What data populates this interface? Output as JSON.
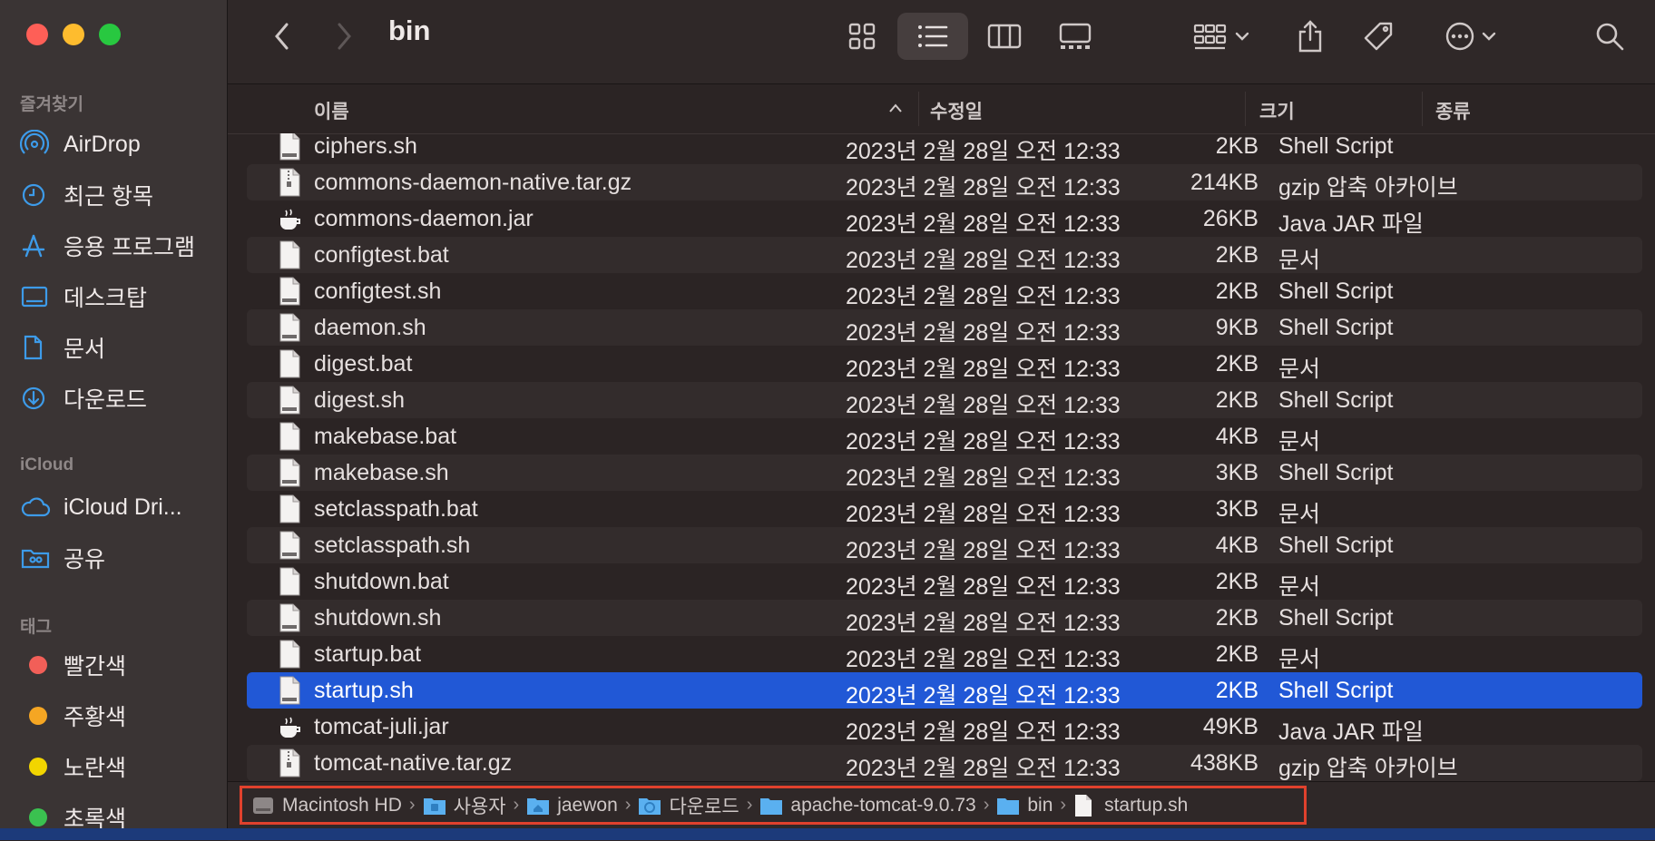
{
  "window": {
    "title": "bin"
  },
  "sidebar": {
    "favorites_heading": "즐겨찾기",
    "favorites": [
      {
        "label": "AirDrop",
        "icon": "airdrop-icon"
      },
      {
        "label": "최근 항목",
        "icon": "clock-icon"
      },
      {
        "label": "응용 프로그램",
        "icon": "applications-icon"
      },
      {
        "label": "데스크탑",
        "icon": "desktop-icon"
      },
      {
        "label": "문서",
        "icon": "document-icon"
      },
      {
        "label": "다운로드",
        "icon": "download-icon"
      }
    ],
    "icloud_heading": "iCloud",
    "icloud": [
      {
        "label": "iCloud Dri...",
        "icon": "cloud-icon"
      },
      {
        "label": "공유",
        "icon": "shared-folder-icon"
      }
    ],
    "tags_heading": "태그",
    "tags": [
      {
        "label": "빨간색",
        "color": "#f25f58"
      },
      {
        "label": "주황색",
        "color": "#f5a623"
      },
      {
        "label": "노란색",
        "color": "#f2d500"
      },
      {
        "label": "초록색",
        "color": "#3ac150"
      }
    ]
  },
  "columns": {
    "name": "이름",
    "date": "수정일",
    "size": "크기",
    "kind": "종류"
  },
  "files": [
    {
      "name": "ciphers.sh",
      "date": "2023년 2월 28일 오전 12:33",
      "size": "2KB",
      "kind": "Shell Script",
      "icon": "shell-script-icon"
    },
    {
      "name": "commons-daemon-native.tar.gz",
      "date": "2023년 2월 28일 오전 12:33",
      "size": "214KB",
      "kind": "gzip 압축 아카이브",
      "icon": "archive-icon"
    },
    {
      "name": "commons-daemon.jar",
      "date": "2023년 2월 28일 오전 12:33",
      "size": "26KB",
      "kind": "Java JAR 파일",
      "icon": "java-jar-icon"
    },
    {
      "name": "configtest.bat",
      "date": "2023년 2월 28일 오전 12:33",
      "size": "2KB",
      "kind": "문서",
      "icon": "document-icon"
    },
    {
      "name": "configtest.sh",
      "date": "2023년 2월 28일 오전 12:33",
      "size": "2KB",
      "kind": "Shell Script",
      "icon": "shell-script-icon"
    },
    {
      "name": "daemon.sh",
      "date": "2023년 2월 28일 오전 12:33",
      "size": "9KB",
      "kind": "Shell Script",
      "icon": "shell-script-icon"
    },
    {
      "name": "digest.bat",
      "date": "2023년 2월 28일 오전 12:33",
      "size": "2KB",
      "kind": "문서",
      "icon": "document-icon"
    },
    {
      "name": "digest.sh",
      "date": "2023년 2월 28일 오전 12:33",
      "size": "2KB",
      "kind": "Shell Script",
      "icon": "shell-script-icon"
    },
    {
      "name": "makebase.bat",
      "date": "2023년 2월 28일 오전 12:33",
      "size": "4KB",
      "kind": "문서",
      "icon": "document-icon"
    },
    {
      "name": "makebase.sh",
      "date": "2023년 2월 28일 오전 12:33",
      "size": "3KB",
      "kind": "Shell Script",
      "icon": "shell-script-icon"
    },
    {
      "name": "setclasspath.bat",
      "date": "2023년 2월 28일 오전 12:33",
      "size": "3KB",
      "kind": "문서",
      "icon": "document-icon"
    },
    {
      "name": "setclasspath.sh",
      "date": "2023년 2월 28일 오전 12:33",
      "size": "4KB",
      "kind": "Shell Script",
      "icon": "shell-script-icon"
    },
    {
      "name": "shutdown.bat",
      "date": "2023년 2월 28일 오전 12:33",
      "size": "2KB",
      "kind": "문서",
      "icon": "document-icon"
    },
    {
      "name": "shutdown.sh",
      "date": "2023년 2월 28일 오전 12:33",
      "size": "2KB",
      "kind": "Shell Script",
      "icon": "shell-script-icon"
    },
    {
      "name": "startup.bat",
      "date": "2023년 2월 28일 오전 12:33",
      "size": "2KB",
      "kind": "문서",
      "icon": "document-icon"
    },
    {
      "name": "startup.sh",
      "date": "2023년 2월 28일 오전 12:33",
      "size": "2KB",
      "kind": "Shell Script",
      "icon": "shell-script-icon",
      "selected": true
    },
    {
      "name": "tomcat-juli.jar",
      "date": "2023년 2월 28일 오전 12:33",
      "size": "49KB",
      "kind": "Java JAR 파일",
      "icon": "java-jar-icon"
    },
    {
      "name": "tomcat-native.tar.gz",
      "date": "2023년 2월 28일 오전 12:33",
      "size": "438KB",
      "kind": "gzip 압축 아카이브",
      "icon": "archive-icon"
    }
  ],
  "path": [
    {
      "label": "Macintosh HD",
      "icon": "hard-drive-icon"
    },
    {
      "label": "사용자",
      "icon": "folder-icon"
    },
    {
      "label": "jaewon",
      "icon": "home-folder-icon"
    },
    {
      "label": "다운로드",
      "icon": "download-folder-icon"
    },
    {
      "label": "apache-tomcat-9.0.73",
      "icon": "folder-icon"
    },
    {
      "label": "bin",
      "icon": "folder-icon"
    },
    {
      "label": "startup.sh",
      "icon": "file-icon"
    }
  ],
  "colors": {
    "selection": "#2158d6",
    "path_highlight": "#e0412d",
    "folder": "#5ab0f0"
  }
}
